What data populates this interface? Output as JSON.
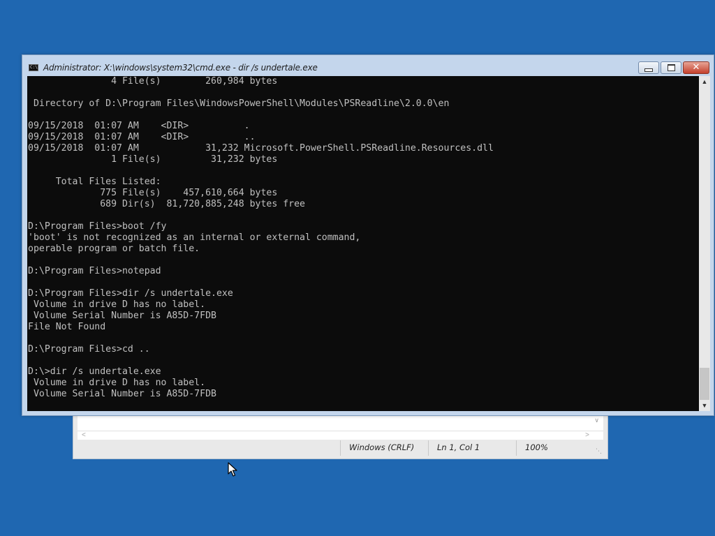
{
  "notepad": {
    "status_encoding": "Windows (CRLF)",
    "status_position": "Ln 1, Col 1",
    "status_zoom": "100%"
  },
  "cmd": {
    "title": "Administrator: X:\\windows\\system32\\cmd.exe - dir  /s undertale.exe",
    "icon_text": "C:\\",
    "console_lines": [
      "               4 File(s)        260,984 bytes",
      "",
      " Directory of D:\\Program Files\\WindowsPowerShell\\Modules\\PSReadline\\2.0.0\\en",
      "",
      "09/15/2018  01:07 AM    <DIR>          .",
      "09/15/2018  01:07 AM    <DIR>          ..",
      "09/15/2018  01:07 AM            31,232 Microsoft.PowerShell.PSReadline.Resources.dll",
      "               1 File(s)         31,232 bytes",
      "",
      "     Total Files Listed:",
      "             775 File(s)    457,610,664 bytes",
      "             689 Dir(s)  81,720,885,248 bytes free",
      "",
      "D:\\Program Files>boot /fy",
      "'boot' is not recognized as an internal or external command,",
      "operable program or batch file.",
      "",
      "D:\\Program Files>notepad",
      "",
      "D:\\Program Files>dir /s undertale.exe",
      " Volume in drive D has no label.",
      " Volume Serial Number is A85D-7FDB",
      "File Not Found",
      "",
      "D:\\Program Files>cd ..",
      "",
      "D:\\>dir /s undertale.exe",
      " Volume in drive D has no label.",
      " Volume Serial Number is A85D-7FDB"
    ]
  },
  "colors": {
    "desktop": "#1f67b1",
    "console_bg": "#0c0c0c",
    "console_fg": "#c0c0c0"
  }
}
